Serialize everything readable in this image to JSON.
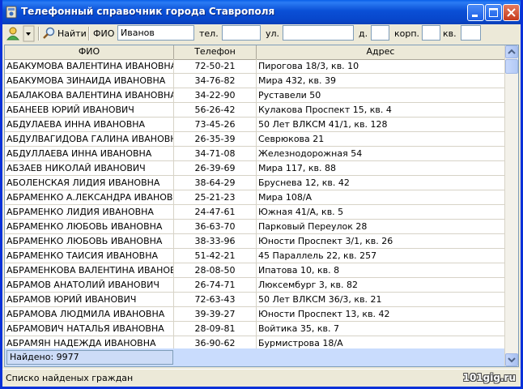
{
  "window": {
    "title": "Телефонный справочник города Ставрополя"
  },
  "toolbar": {
    "search_label": "Найти",
    "fio_label": "ФИО",
    "fio_value": "Иванов",
    "phone_label": "тел.",
    "phone_value": "",
    "street_label": "ул.",
    "street_value": "",
    "house_label": "д.",
    "house_value": "",
    "building_label": "корп.",
    "building_value": "",
    "apartment_label": "кв.",
    "apartment_value": ""
  },
  "table": {
    "columns": [
      "ФИО",
      "Телефон",
      "Адрес"
    ],
    "rows": [
      [
        "АБАКУМОВА ВАЛЕНТИНА ИВАНОВНА",
        "72-50-21",
        "Пирогова 18/3, кв. 10"
      ],
      [
        "АБАКУМОВА ЗИНАИДА ИВАНОВНА",
        "34-76-82",
        "Мира 432, кв. 39"
      ],
      [
        "АБАЛАКОВА ВАЛЕНТИНА ИВАНОВНА",
        "34-22-90",
        "Руставели 50"
      ],
      [
        "АБАНЕЕВ ЮРИЙ ИВАНОВИЧ",
        "56-26-42",
        "Кулакова Проспект 15, кв. 4"
      ],
      [
        "АБДУЛАЕВА ИННА ИВАНОВНА",
        "73-45-26",
        "50 Лет ВЛКСМ 41/1, кв. 128"
      ],
      [
        "АБДУЛВАГИДОВА ГАЛИНА ИВАНОВНА",
        "26-35-39",
        "Севрюкова 21"
      ],
      [
        "АБДУЛЛАЕВА ИННА ИВАНОВНА",
        "34-71-08",
        "Железнодорожная 54"
      ],
      [
        "АБЗАЕВ НИКОЛАЙ ИВАНОВИЧ",
        "26-39-69",
        "Мира 117, кв. 88"
      ],
      [
        "АБОЛЕНСКАЯ ЛИДИЯ ИВАНОВНА",
        "38-64-29",
        "Бруснева 12, кв. 42"
      ],
      [
        "АБРАМЕНКО А.ЛЕКСАНДРА ИВАНОВНА",
        "25-21-23",
        "Мира 108/А"
      ],
      [
        "АБРАМЕНКО ЛИДИЯ ИВАНОВНА",
        "24-47-61",
        "Южная 41/А, кв. 5"
      ],
      [
        "АБРАМЕНКО ЛЮБОВЬ ИВАНОВНА",
        "36-63-70",
        "Парковый Переулок 28"
      ],
      [
        "АБРАМЕНКО ЛЮБОВЬ ИВАНОВНА",
        "38-33-96",
        "Юности Проспект 3/1, кв. 26"
      ],
      [
        "АБРАМЕНКО ТАИСИЯ ИВАНОВНА",
        "51-42-21",
        "45 Параллель 22, кв. 257"
      ],
      [
        "АБРАМЕНКОВА ВАЛЕНТИНА ИВАНОВНА",
        "28-08-50",
        "Ипатова 10, кв. 8"
      ],
      [
        "АБРАМОВ АНАТОЛИЙ ИВАНОВИЧ",
        "26-74-71",
        "Люксембург 3, кв. 82"
      ],
      [
        "АБРАМОВ ЮРИЙ ИВАНОВИЧ",
        "72-63-43",
        "50 Лет ВЛКСМ 36/3, кв. 21"
      ],
      [
        "АБРАМОВА ЛЮДМИЛА ИВАНОВНА",
        "39-39-27",
        "Юности Проспект 13, кв. 42"
      ],
      [
        "АБРАМОВИЧ НАТАЛЬЯ ИВАНОВНА",
        "28-09-81",
        "Войтика 35, кв. 7"
      ],
      [
        "АБРАМЯН НАДЕЖДА ИВАНОВНА",
        "36-90-62",
        "Бурмистрова 18/А"
      ]
    ]
  },
  "found_text": "Найдено: 9977",
  "status": {
    "text": "Списко найденых граждан"
  },
  "watermark": "101gig.ru"
}
